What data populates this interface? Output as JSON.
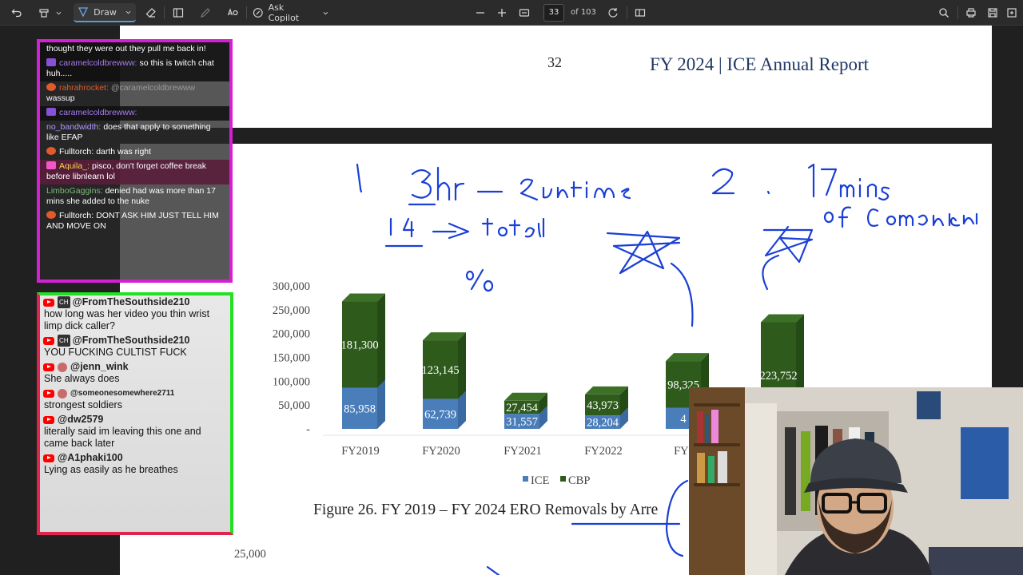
{
  "toolbar": {
    "draw_label": "Draw",
    "copilot_label": "Ask Copilot",
    "page_current": "33",
    "page_total": "of 103"
  },
  "document": {
    "top_page_number": "32",
    "report_title": "FY 2024 | ICE Annual Report",
    "figure_caption": "Figure 26. FY 2019 – FY 2024 ERO Removals by Arre",
    "next_chart_tick": "25,000"
  },
  "chart_data": {
    "type": "bar",
    "stacked": true,
    "categories": [
      "FY2019",
      "FY2020",
      "FY2021",
      "FY2022",
      "FY2",
      ""
    ],
    "series": [
      {
        "name": "ICE",
        "color": "#4a7ebb",
        "values": [
          85958,
          62739,
          31557,
          28204,
          44000,
          null
        ],
        "labels": [
          "85,958",
          "62,739",
          "31,557",
          "28,204",
          "4",
          ""
        ]
      },
      {
        "name": "CBP",
        "color": "#2e5a1c",
        "values": [
          181300,
          123145,
          27454,
          43973,
          98325,
          223752
        ],
        "labels": [
          "181,300",
          "123,145",
          "27,454",
          "43,973",
          "98,325",
          "223,752"
        ]
      }
    ],
    "yticks": [
      "300,000",
      "250,000",
      "200,000",
      "150,000",
      "100,000",
      "50,000",
      "-"
    ],
    "ylim": [
      0,
      300000
    ],
    "legend_position": "bottom"
  },
  "annotations": {
    "note1": "1.",
    "note1_text": "3hr — Runtime",
    "note1_sub": "1.4 —> total",
    "note2": "2.",
    "note2_text": "17mins",
    "note2_sub": "of Commentary",
    "percent": "0%"
  },
  "twitch_chat": [
    {
      "user": "",
      "text": "thought they were out they pull me back in!",
      "user_color": "#bbbbbb",
      "style": "dark"
    },
    {
      "user": "caramelcoldbrewww:",
      "text": "so this is twitch chat huh.....",
      "user_color": "#a77bf3",
      "badge": "purple",
      "style": "dark"
    },
    {
      "user": "rahrahrocket:",
      "text": "@caramelcoldbrewww",
      "text2": "wassup",
      "user_color": "#e05a2b",
      "badge": "orange",
      "style": "normal"
    },
    {
      "user": "caramelcoldbrewww:",
      "text": "",
      "user_color": "#a77bf3",
      "badge": "purple",
      "style": "dark"
    },
    {
      "user": "no_bandwidth:",
      "text": "does that apply to something like EFAP",
      "user_color": "#b197fc",
      "style": "normal"
    },
    {
      "user": "Fulltorch:",
      "text": "darth was right",
      "user_color": "#ffffff",
      "badge": "orange",
      "style": "normal"
    },
    {
      "user": "Aquila_:",
      "text": "pisco, don't forget coffee break before libnlearn lol",
      "user_color": "#ffd84a",
      "badge": "pink",
      "style": "hl"
    },
    {
      "user": "LimboGaggins:",
      "text": "denied had was more than 17 mins she added to the nuke",
      "user_color": "#7cb87c",
      "style": "normal"
    },
    {
      "user": "Fulltorch:",
      "text": "DONT ASK HIM JUST TELL HIM AND MOVE ON",
      "user_color": "#ffffff",
      "badge": "orange",
      "style": "normal"
    }
  ],
  "youtube_chat": [
    {
      "user": "@FromTheSouthside210",
      "badge": "CH",
      "text": "how long was her video you thin wrist limp dick caller?"
    },
    {
      "user": "@FromTheSouthside210",
      "badge": "CH",
      "text": "YOU FUCKING CULTIST FUCK"
    },
    {
      "user": "@jenn_wink",
      "avatar": true,
      "text": "She always does"
    },
    {
      "user": "@someonesomewhere2711",
      "avatar": true,
      "small": true,
      "text": "strongest soldiers"
    },
    {
      "user": "@dw2579",
      "text": "literally said im leaving this one and came back later"
    },
    {
      "user": "@A1phaki100",
      "text": "Lying as easily as he breathes"
    }
  ],
  "colors": {
    "ice": "#4a7ebb",
    "cbp": "#2e5a1c",
    "ink": "#1a3fd6",
    "twitch_border": "#d41fd4",
    "youtube_border": "#24e024"
  }
}
